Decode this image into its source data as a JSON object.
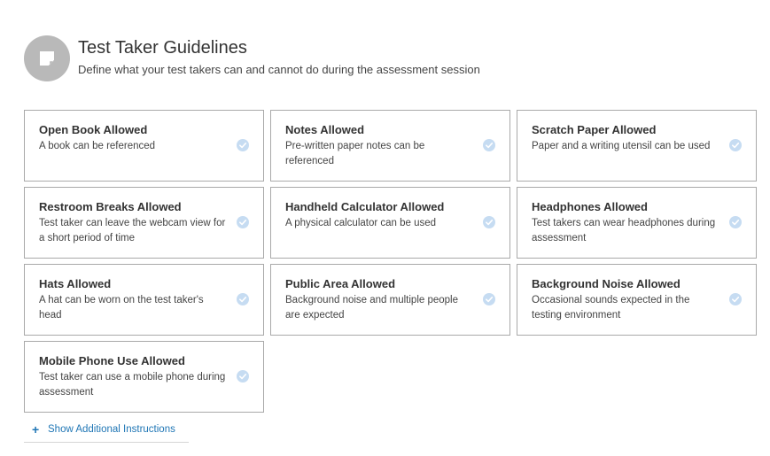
{
  "header": {
    "icon": "sticky-note-icon",
    "title": "Test Taker Guidelines",
    "subtitle": "Define what your test takers can and cannot do during the assessment session"
  },
  "guidelines": [
    {
      "title": "Open Book Allowed",
      "description": "A book can be referenced",
      "selected": true
    },
    {
      "title": "Notes Allowed",
      "description": "Pre-written paper notes can be referenced",
      "selected": true
    },
    {
      "title": "Scratch Paper Allowed",
      "description": "Paper and a writing utensil can be used",
      "selected": true
    },
    {
      "title": "Restroom Breaks Allowed",
      "description": "Test taker can leave the webcam view for a short period of time",
      "selected": true
    },
    {
      "title": "Handheld Calculator Allowed",
      "description": "A physical calculator can be used",
      "selected": true
    },
    {
      "title": "Headphones Allowed",
      "description": "Test takers can wear headphones during assessment",
      "selected": true
    },
    {
      "title": "Hats Allowed",
      "description": "A hat can be worn on the test taker's head",
      "selected": true
    },
    {
      "title": "Public Area Allowed",
      "description": "Background noise and multiple people are expected",
      "selected": true
    },
    {
      "title": "Background Noise Allowed",
      "description": "Occasional sounds expected in the testing environment",
      "selected": true
    },
    {
      "title": "Mobile Phone Use Allowed",
      "description": "Test taker can use a mobile phone during assessment",
      "selected": true
    }
  ],
  "additional_instructions": {
    "icon": "plus-icon",
    "label": "Show Additional Instructions"
  },
  "colors": {
    "accent": "#1f76b5",
    "check": "#c6dcf2",
    "icon_bg": "#b9b9b9",
    "border": "#a9a9a9"
  }
}
